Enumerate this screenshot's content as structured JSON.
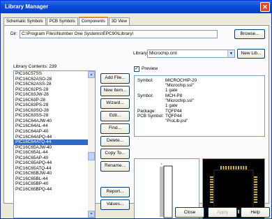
{
  "window": {
    "title": "Library Manager",
    "close_glyph": "✕"
  },
  "tabs": [
    {
      "label": "Schematic Symbols"
    },
    {
      "label": "PCB Symbols"
    },
    {
      "label": "Components"
    },
    {
      "label": "3D View"
    }
  ],
  "dir": {
    "label": "Dir:",
    "value": "C:\\Program Files\\Number One Systems\\EPC90\\Library\\",
    "browse": "Browse..."
  },
  "library": {
    "label": "Library:",
    "value": "Microchip.cml",
    "new_lib": "New Lib..."
  },
  "contents": {
    "label": "Library Contents:",
    "count": "239"
  },
  "items": [
    "PIC16C57SS",
    "PIC16C62ASO-28",
    "PIC16C62ASS-28",
    "PIC16C62PS-28",
    "PIC16C63JW-28",
    "PIC16C63P-28",
    "PIC16C63PS-28",
    "PIC16C63SO-28",
    "PIC16C63SS-28",
    "PIC16C64AJW-40",
    "PIC16C64AL-44",
    "PIC16C64AP-40",
    "PIC16C64APQ-44",
    "PIC16C64ATQ-44",
    "PIC16C65AJW-40",
    "PIC16C65AL-44",
    "PIC16C65AP-40",
    "PIC16C65APQ-44",
    "PIC16C65ATQ-44",
    "PIC16C65BJW-40",
    "PIC16C65BL-44",
    "PIC16C65BP-40",
    "PIC16C65BPQ-44"
  ],
  "selected_item": "PIC16C64ATQ-44",
  "buttons": {
    "add": "Add File...",
    "new": "New Item...",
    "wizard": "Wizard...",
    "edit": "Edit...",
    "find": "Find...",
    "delete": "Delete...",
    "copy": "Copy To...",
    "rename": "Rename...",
    "report": "Report...",
    "values": "Values..."
  },
  "preview": {
    "label": "Preview",
    "checked": "✓",
    "symbol1_key": "Symbol:",
    "symbol1_name": "MICROCHIP-20",
    "symbol1_lib": "\"Microchip.ssl\"",
    "symbol1_gates": "1 gate",
    "symbol2_key": "Symbol:",
    "symbol2_name": "MCH-P8",
    "symbol2_lib": "\"Microchip.ssl\"",
    "symbol2_gates": "1 gate",
    "package_key": "Package:",
    "package_val": "TQFP44",
    "pcb_key": "PCB Symbol:",
    "pcb_val": "TQFP44",
    "pcb_lib": "\"ProLib.psl\""
  },
  "footer": {
    "close": "Close",
    "apply": "Apply",
    "help": "Help"
  },
  "icons": {
    "scroll_up": "▲",
    "scroll_down": "▼",
    "dropdown": "▼"
  },
  "colors": {
    "titlebar": "#0a4ad8",
    "selection": "#316ac5",
    "pcb_bg": "#000000",
    "pad": "#e8c060"
  }
}
